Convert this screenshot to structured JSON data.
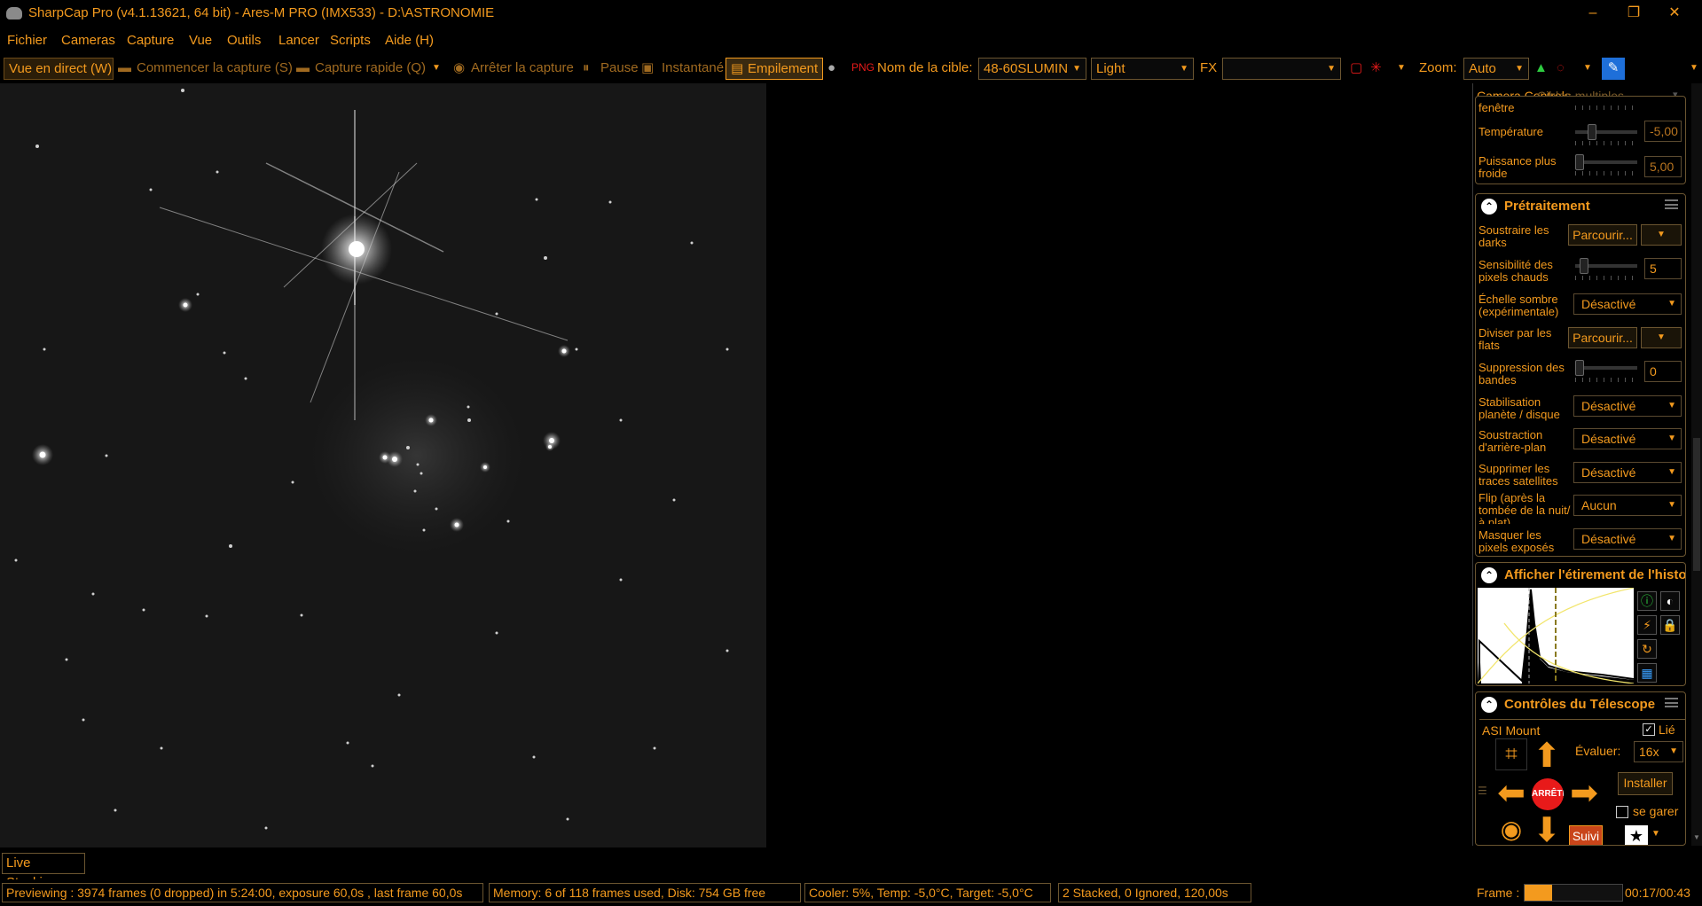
{
  "window": {
    "title": "SharpCap Pro (v4.1.13621, 64 bit) - Ares-M PRO (IMX533) - D:\\ASTRONOMIE",
    "minimize": "–",
    "restore": "❐",
    "close": "✕"
  },
  "menu": [
    "Fichier",
    "Cameras",
    "Capture",
    "Vue",
    "Outils",
    "Lancer",
    "Scripts",
    "Aide (H)"
  ],
  "toolbar": {
    "live_view": "Vue en direct (W)",
    "start_capture": "Commencer la capture (S)",
    "quick_capture": "Capture rapide (Q)",
    "stop_capture": "Arrêter la capture",
    "pause": "Pause",
    "snapshot": "Instantané",
    "stacking": "Empilement",
    "target_label": "Nom de la cible:",
    "target_value": "48-60SLUMIN",
    "frame_type": "Light",
    "fx_label": "FX",
    "fx_value": "",
    "zoom_label": "Zoom:",
    "zoom_value": "Auto"
  },
  "panel": {
    "tabs": [
      "Camera Controls",
      "Cibles multiples"
    ],
    "camera_rows": {
      "window_label": "fenêtre",
      "temperature_label": "Température",
      "temperature_value": "-5,00",
      "cooler_label": "Puissance plus froide",
      "cooler_value": "5,00"
    },
    "preprocessing": {
      "title": "Prétraitement",
      "subtract_darks": "Soustraire les darks",
      "browse": "Parcourir...",
      "hot_pixel": "Sensibilité des pixels chauds",
      "hot_pixel_value": "5",
      "dark_scale": "Échelle sombre (expérimentale)",
      "dark_scale_value": "Désactivé",
      "divide_flats": "Diviser par les flats",
      "banding": "Suppression des bandes",
      "banding_value": "0",
      "stabilization": "Stabilisation planète / disque",
      "stabilization_value": "Désactivé",
      "bg_subtraction": "Soustraction d'arrière-plan",
      "bg_subtraction_value": "Désactivé",
      "satellite": "Supprimer les traces satellites",
      "satellite_value": "Désactivé",
      "flip": "Flip (après la tombée de la nuit/à plat)",
      "flip_value": "Aucun",
      "mask": "Masquer les pixels exposés",
      "mask_value": "Désactivé"
    },
    "histogram": {
      "title": "Afficher l'étirement de l'histogramme"
    },
    "telescope": {
      "title": "Contrôles du Télescope",
      "mount": "ASI Mount",
      "linked": "Lié",
      "rate_label": "Évaluer:",
      "rate_value": "16x",
      "stop": "ARRÊTER",
      "install": "Installer",
      "park": "se garer",
      "tracking": "Suivi"
    }
  },
  "bottom": {
    "live_stacking_tab": "Live Stacking",
    "status_preview": "Previewing : 3974 frames (0 dropped) in 5:24:00, exposure 60,0s , last frame 60,0s",
    "status_memory": "Memory: 6 of 118 frames used, Disk: 754 GB free",
    "status_cooler": "Cooler: 5%, Temp: -5,0°C, Target: -5,0°C",
    "status_stack": "2 Stacked, 0 Ignored, 120,00s",
    "frame_label": "Frame :",
    "frame_progress": 0.28,
    "frame_time": "00:17/00:43"
  },
  "colors": {
    "accent": "#f39a1e",
    "background": "#000000",
    "stop_red": "#e81a1a"
  }
}
